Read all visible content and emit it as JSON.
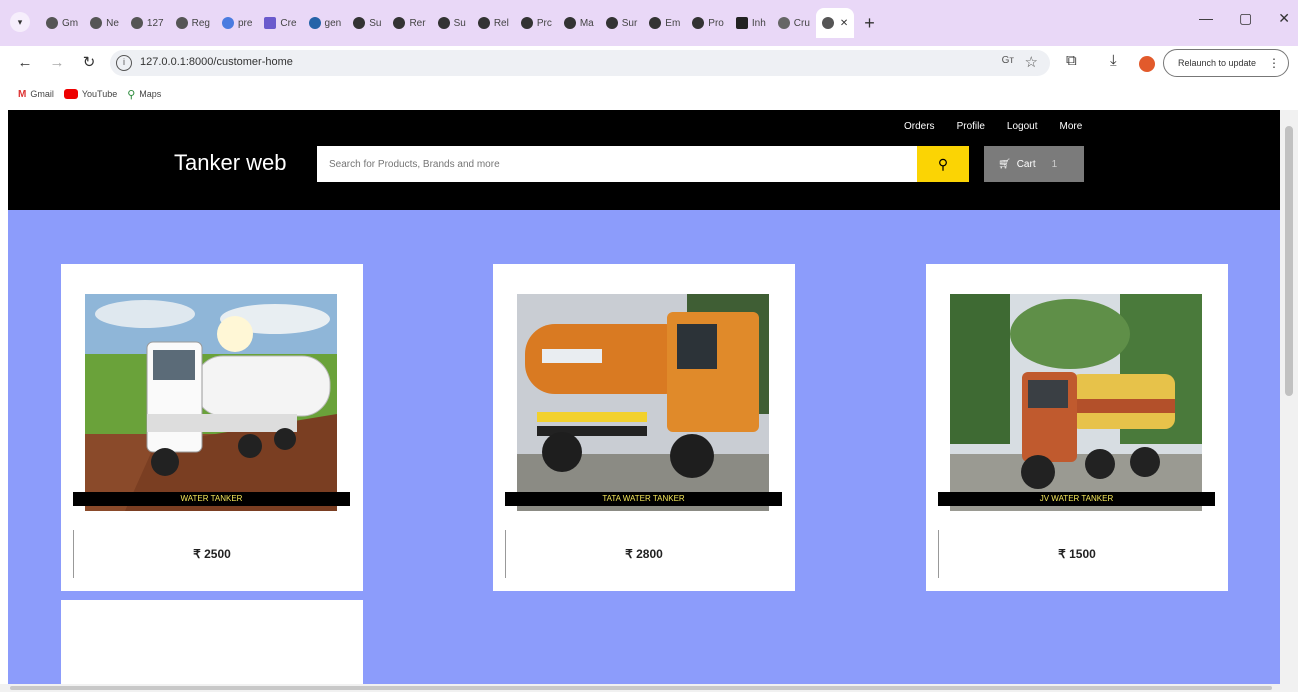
{
  "browser": {
    "tabs": [
      {
        "label": "Gm"
      },
      {
        "label": "Ne"
      },
      {
        "label": "127"
      },
      {
        "label": "Reg"
      },
      {
        "label": "pre"
      },
      {
        "label": "Cre"
      },
      {
        "label": "gen"
      },
      {
        "label": "Su"
      },
      {
        "label": "Rer"
      },
      {
        "label": "Su"
      },
      {
        "label": "Rel"
      },
      {
        "label": "Prc"
      },
      {
        "label": "Ma"
      },
      {
        "label": "Sur"
      },
      {
        "label": "Em"
      },
      {
        "label": "Pro"
      },
      {
        "label": "Inh"
      },
      {
        "label": "Cru"
      }
    ],
    "url": "127.0.0.1:8000/customer-home",
    "relaunch_label": "Relaunch to update",
    "bookmarks": [
      "Gmail",
      "YouTube",
      "Maps"
    ]
  },
  "site": {
    "brand": "Tanker web",
    "search_placeholder": "Search for Products, Brands and more",
    "cart_label": "Cart",
    "cart_count": "1",
    "nav": [
      "Orders",
      "Profile",
      "Logout",
      "More"
    ],
    "colors": {
      "header": "#000000",
      "page_bg": "#8c9cfb",
      "search_button": "#fbd404",
      "cart_button": "#7b7b7b",
      "product_name": "#f4e75a"
    }
  },
  "products": [
    {
      "name": "WATER TANKER",
      "price": "₹ 2500",
      "image": "white-water-tanker-photo"
    },
    {
      "name": "TATA WATER TANKER",
      "price": "₹ 2800",
      "image": "orange-tata-tanker-photo"
    },
    {
      "name": "JV WATER TANKER",
      "price": "₹ 1500",
      "image": "yellow-tanker-photo"
    }
  ]
}
